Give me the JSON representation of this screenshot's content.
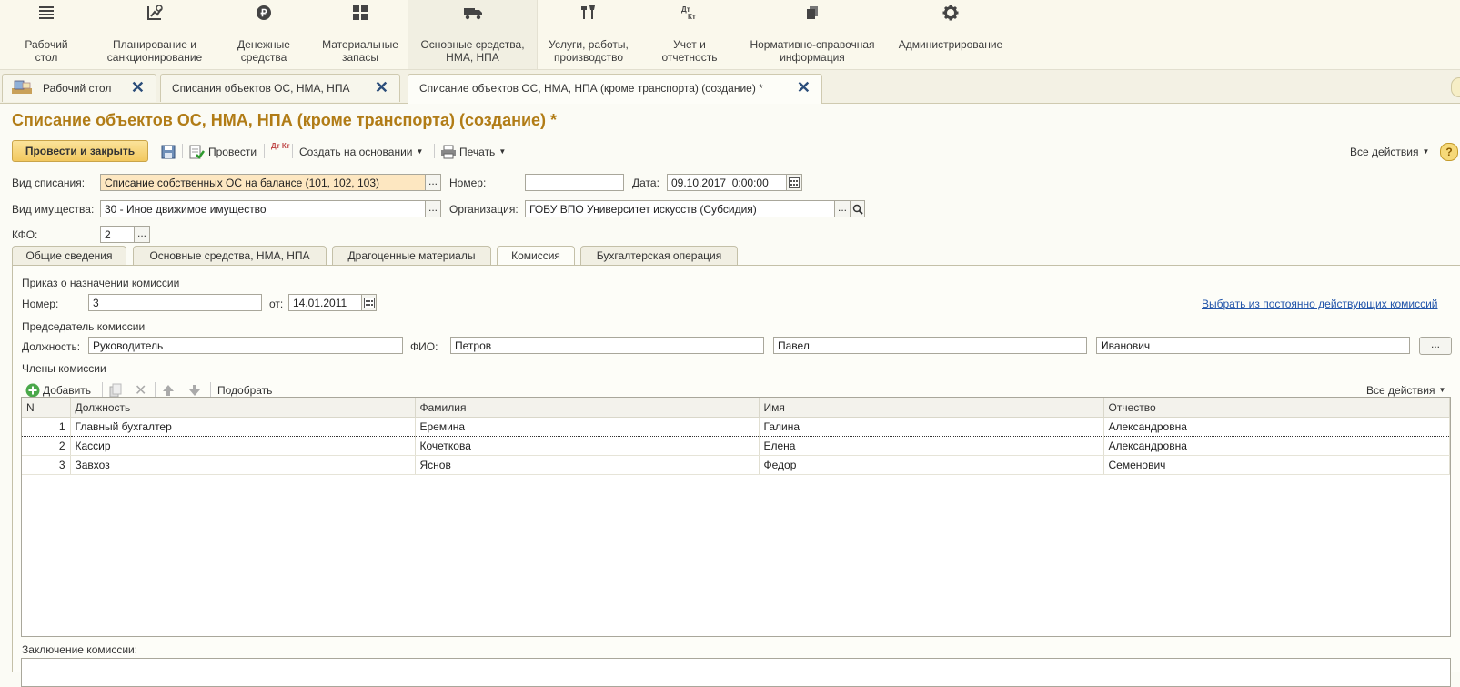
{
  "sections": [
    {
      "label": "Рабочий\nстол",
      "icon": "menu-icon"
    },
    {
      "label": "Планирование и\nсанкционирование",
      "icon": "planning-icon"
    },
    {
      "label": "Денежные\nсредства",
      "icon": "ruble-coin-icon"
    },
    {
      "label": "Материальные\nзапасы",
      "icon": "grid-icon"
    },
    {
      "label": "Основные средства,\nНМА, НПА",
      "icon": "truck-icon"
    },
    {
      "label": "Услуги, работы,\nпроизводство",
      "icon": "tools-icon"
    },
    {
      "label": "Учет и\nотчетность",
      "icon": "debit-credit-icon"
    },
    {
      "label": "Нормативно-справочная\nинформация",
      "icon": "books-icon"
    },
    {
      "label": "Администрирование",
      "icon": "gear-icon"
    }
  ],
  "window_tabs": [
    {
      "label": "Рабочий стол"
    },
    {
      "label": "Списания объектов ОС, НМА, НПА"
    },
    {
      "label": "Списание объектов ОС, НМА, НПА (кроме транспорта) (создание) *"
    }
  ],
  "title": "Списание объектов ОС, НМА, НПА (кроме транспорта) (создание) *",
  "toolbar": {
    "post_close": "Провести и закрыть",
    "post": "Провести",
    "create_based": "Создать на основании",
    "print": "Печать",
    "all_actions": "Все действия",
    "help": "?",
    "dtkt": "Дт Кт"
  },
  "form": {
    "vid_spisaniya_label": "Вид списания:",
    "vid_spisaniya": "Списание собственных ОС на балансе (101, 102, 103)",
    "nomer_label": "Номер:",
    "nomer": "",
    "data_label": "Дата:",
    "data": "09.10.2017  0:00:00",
    "vid_imush_label": "Вид имущества:",
    "vid_imush": "30 - Иное движимое имущество",
    "org_label": "Организация:",
    "org": "ГОБУ ВПО Университет искусств (Субсидия)",
    "kfo_label": "КФО:",
    "kfo": "2",
    "ellipsis": "..."
  },
  "form_tabs": [
    {
      "label": "Общие сведения"
    },
    {
      "label": "Основные средства, НМА, НПА"
    },
    {
      "label": "Драгоценные материалы"
    },
    {
      "label": "Комиссия"
    },
    {
      "label": "Бухгалтерская операция"
    }
  ],
  "commission": {
    "order_header": "Приказ о назначении комиссии",
    "num_label": "Номер:",
    "num": "3",
    "from_label": "от:",
    "from": "14.01.2011",
    "choose_link": "Выбрать из постоянно действующих комиссий",
    "chair_header": "Председатель комиссии",
    "position_label": "Должность:",
    "position": "Руководитель",
    "fio_label": "ФИО:",
    "surname": "Петров",
    "name": "Павел",
    "patronymic": "Иванович",
    "members_header": "Члены комиссии",
    "add": "Добавить",
    "pick": "Подобрать",
    "all_actions": "Все действия",
    "conclusion_label": "Заключение комиссии:"
  },
  "grid": {
    "columns": [
      "N",
      "Должность",
      "Фамилия",
      "Имя",
      "Отчество"
    ],
    "rows": [
      [
        "1",
        "Главный бухгалтер",
        "Еремина",
        "Галина",
        "Александровна"
      ],
      [
        "2",
        "Кассир",
        "Кочеткова",
        "Елена",
        "Александровна"
      ],
      [
        "3",
        "Завхоз",
        "Яснов",
        "Федор",
        "Семенович"
      ]
    ]
  }
}
